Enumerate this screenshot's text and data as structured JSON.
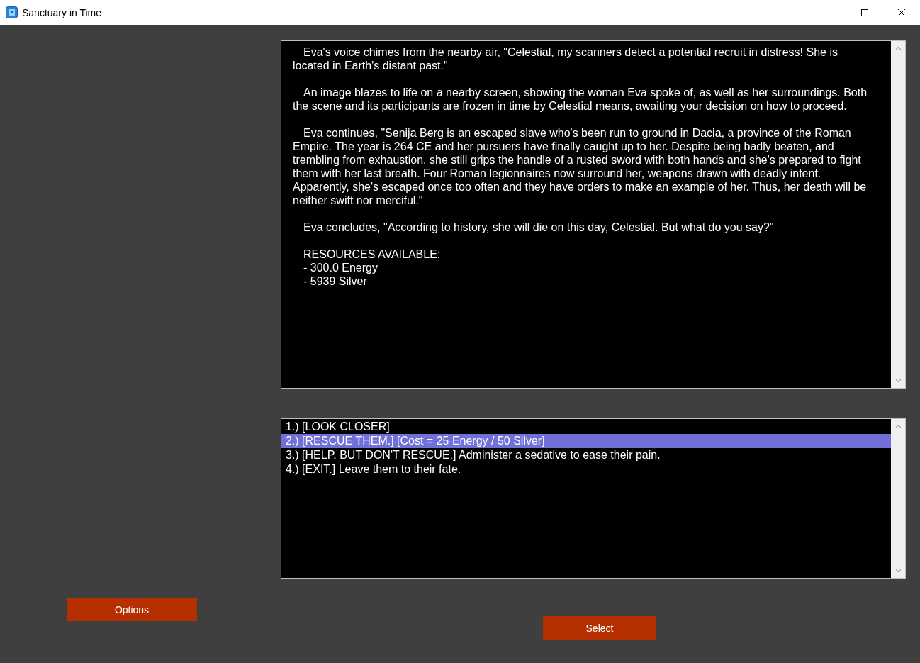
{
  "window": {
    "title": "Sanctuary in Time"
  },
  "story": {
    "paragraphs": [
      "Eva's voice chimes from the nearby air, \"Celestial, my scanners detect a potential recruit in distress! She is located in Earth's distant past.\"",
      "An image blazes to life on a nearby screen, showing the woman Eva spoke of, as well as her surroundings. Both the scene and its participants are frozen in time by Celestial means, awaiting your decision on how to proceed.",
      "Eva continues, \"Senija Berg is an escaped slave who's been run to ground in Dacia, a province of the Roman Empire. The year is 264 CE and her pursuers have finally caught up to her. Despite being badly beaten, and trembling from exhaustion, she still grips the handle of a rusted sword with both hands and she's prepared to fight them with her last breath. Four Roman legionnaires now surround her, weapons drawn with deadly intent. Apparently, she's escaped once too often and they have orders to make an example of her. Thus, her death will be neither swift nor merciful.\"",
      "Eva concludes, \"According to history, she will die on this day, Celestial. But what do you say?\""
    ],
    "resources": {
      "heading": "RESOURCES AVAILABLE:",
      "items": [
        "- 300.0 Energy",
        "- 5939 Silver"
      ]
    }
  },
  "choices": [
    {
      "label": "1.) [LOOK CLOSER]",
      "selected": false
    },
    {
      "label": "2.) [RESCUE THEM.] [Cost = 25 Energy / 50 Silver]",
      "selected": true
    },
    {
      "label": "3.) [HELP, BUT DON'T RESCUE.] Administer a sedative to ease their pain.",
      "selected": false
    },
    {
      "label": "4.) [EXIT.] Leave them to their fate.",
      "selected": false
    }
  ],
  "buttons": {
    "options": "Options",
    "select": "Select"
  }
}
